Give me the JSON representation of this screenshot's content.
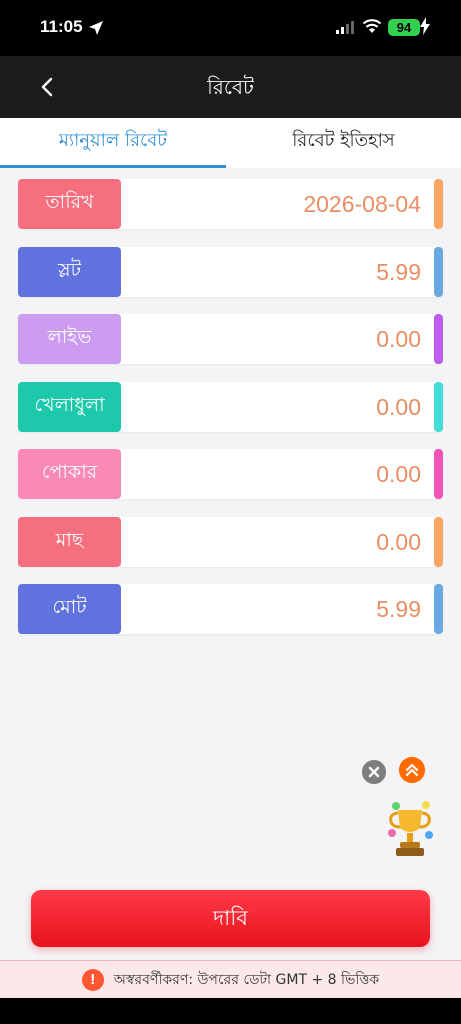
{
  "status_bar": {
    "time": "11:05",
    "battery": "94"
  },
  "header": {
    "title": "রিবেট"
  },
  "tabs": [
    {
      "label": "ম্যানুয়াল রিবেট",
      "active": true
    },
    {
      "label": "রিবেট ইতিহাস",
      "active": false
    }
  ],
  "rows": [
    {
      "label": "তারিখ",
      "value": "2026-08-04",
      "label_color": "#f66f7f",
      "stripe_color": "#f7a664"
    },
    {
      "label": "স্লট",
      "value": "5.99",
      "label_color": "#5f72de",
      "stripe_color": "#6aa8e2"
    },
    {
      "label": "লাইভ",
      "value": "0.00",
      "label_color": "#cc9cf1",
      "stripe_color": "#bb5eef"
    },
    {
      "label": "খেলাধুলা",
      "value": "0.00",
      "label_color": "#1ec8ab",
      "stripe_color": "#43ddd8"
    },
    {
      "label": "পোকার",
      "value": "0.00",
      "label_color": "#f98ab5",
      "stripe_color": "#f154b4"
    },
    {
      "label": "মাছ",
      "value": "0.00",
      "label_color": "#f66f7f",
      "stripe_color": "#f7a664"
    },
    {
      "label": "মোট",
      "value": "5.99",
      "label_color": "#5f72de",
      "stripe_color": "#6aa8e2"
    }
  ],
  "claim_button": {
    "label": "দাবি"
  },
  "disclaimer": {
    "text": "অস্বরবর্ণীকরণ: উপরের ডেটা GMT + 8 ভিত্তিক"
  }
}
